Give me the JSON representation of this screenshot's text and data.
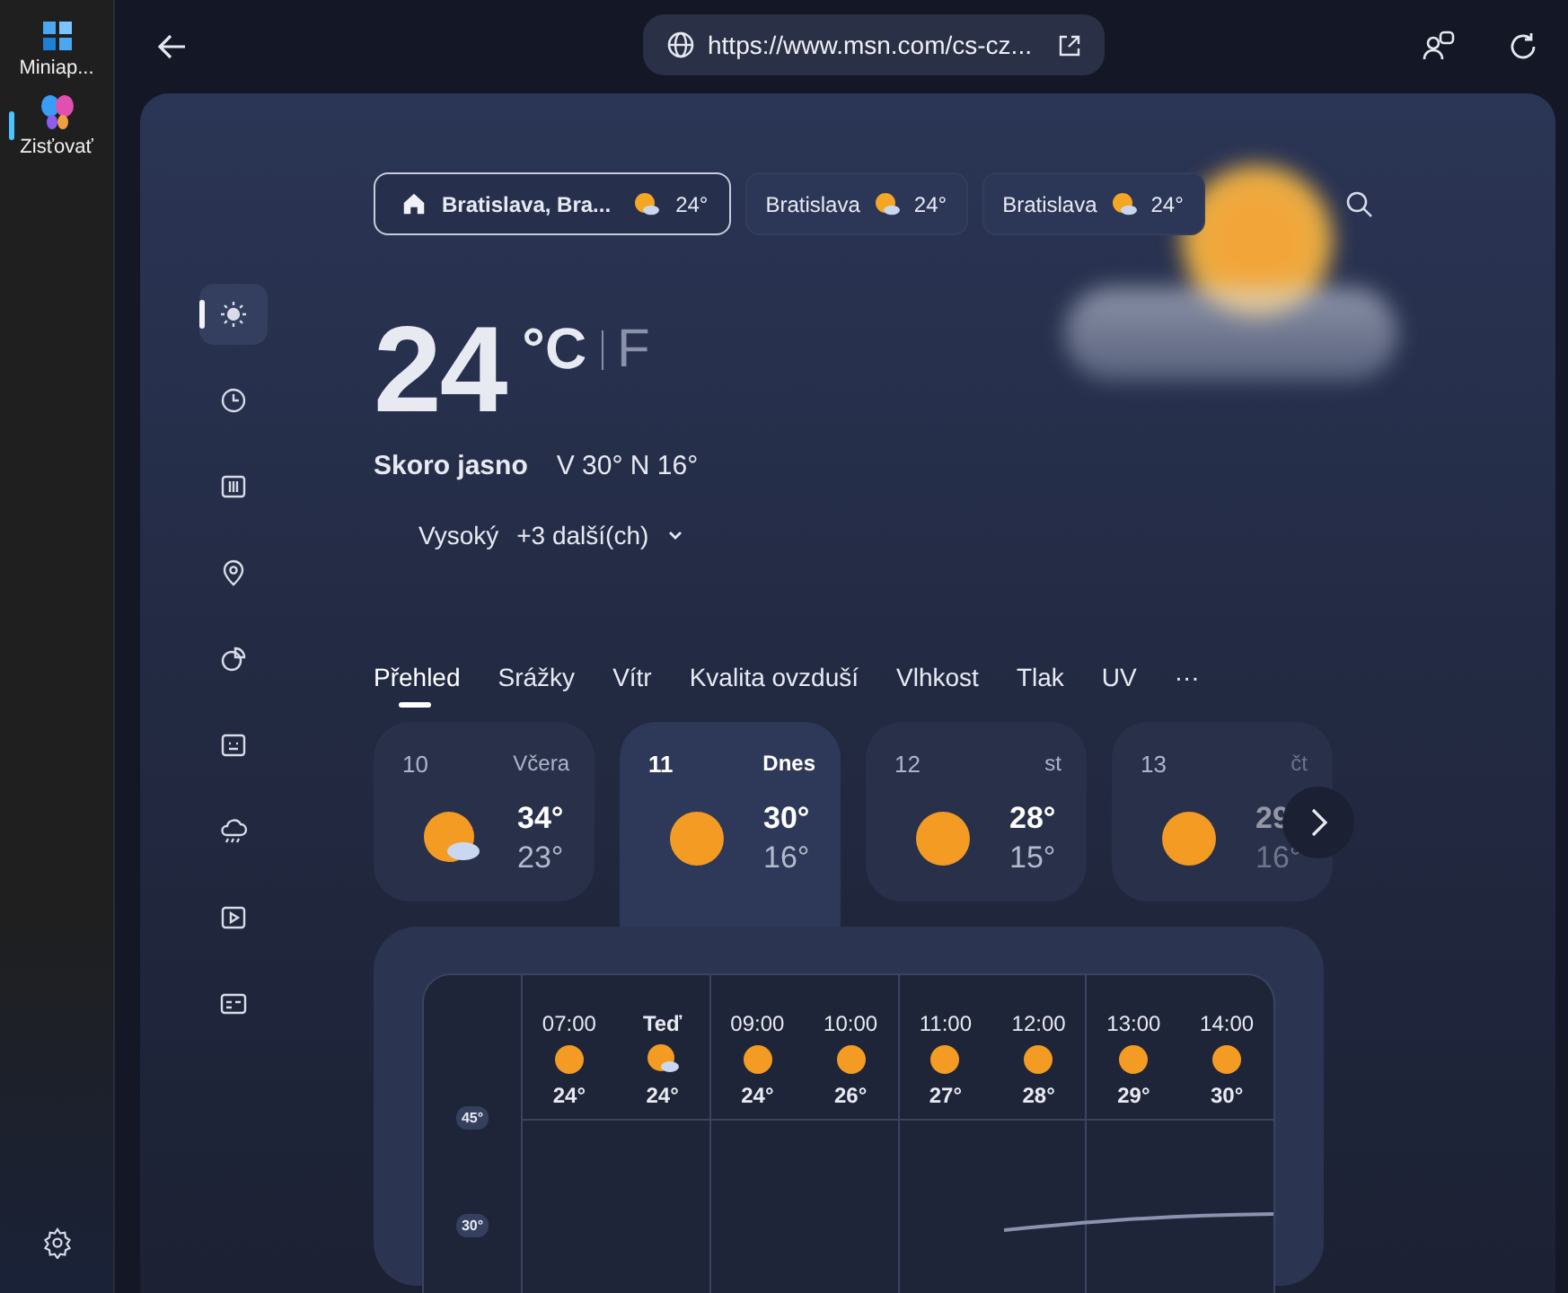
{
  "app_rail": {
    "items": [
      {
        "label": "Miniap...",
        "kind": "apps",
        "selected": false
      },
      {
        "label": "Zisťovať",
        "kind": "discover",
        "selected": true
      }
    ]
  },
  "address_bar": {
    "url": "https://www.msn.com/cs-cz..."
  },
  "locations": [
    {
      "name": "Bratislava, Bra...",
      "temp": "24°",
      "home": true,
      "selected": true
    },
    {
      "name": "Bratislava",
      "temp": "24°",
      "home": false,
      "selected": false
    },
    {
      "name": "Bratislava",
      "temp": "24°",
      "home": false,
      "selected": false
    }
  ],
  "nav": [
    {
      "kind": "sun",
      "selected": true
    },
    {
      "kind": "clock",
      "selected": false
    },
    {
      "kind": "calendar",
      "selected": false
    },
    {
      "kind": "pin",
      "selected": false
    },
    {
      "kind": "pie",
      "selected": false
    },
    {
      "kind": "grid",
      "selected": false
    },
    {
      "kind": "cloud",
      "selected": false
    },
    {
      "kind": "video",
      "selected": false
    },
    {
      "kind": "card",
      "selected": false
    }
  ],
  "current": {
    "temp": "24",
    "unit_c": "°C",
    "unit_f": "F",
    "condition": "Skoro jasno",
    "high_low": "V 30°  N 16°",
    "alert": "Vysoký",
    "more": "+3 další(ch)"
  },
  "tabs": [
    {
      "label": "Přehled",
      "selected": true
    },
    {
      "label": "Srážky",
      "selected": false
    },
    {
      "label": "Vítr",
      "selected": false
    },
    {
      "label": "Kvalita ovzduší",
      "selected": false
    },
    {
      "label": "Vlhkost",
      "selected": false
    },
    {
      "label": "Tlak",
      "selected": false
    },
    {
      "label": "UV",
      "selected": false
    },
    {
      "label": "···",
      "selected": false
    }
  ],
  "days": [
    {
      "date": "10",
      "label": "Včera",
      "high": "34°",
      "low": "23°",
      "kind": "sun-cloud",
      "selected": false
    },
    {
      "date": "11",
      "label": "Dnes",
      "high": "30°",
      "low": "16°",
      "kind": "sun",
      "selected": true
    },
    {
      "date": "12",
      "label": "st",
      "high": "28°",
      "low": "15°",
      "kind": "sun",
      "selected": false
    },
    {
      "date": "13",
      "label": "čt",
      "high": "29",
      "low": "16°",
      "kind": "sun",
      "selected": false
    }
  ],
  "hourly": [
    {
      "time": "07:00",
      "kind": "sun",
      "temp": "24°",
      "now": false
    },
    {
      "time": "Teď",
      "kind": "sun-cloud",
      "temp": "24°",
      "now": true
    },
    {
      "time": "09:00",
      "kind": "sun",
      "temp": "24°",
      "now": false
    },
    {
      "time": "10:00",
      "kind": "sun",
      "temp": "26°",
      "now": false
    },
    {
      "time": "11:00",
      "kind": "sun",
      "temp": "27°",
      "now": false
    },
    {
      "time": "12:00",
      "kind": "sun",
      "temp": "28°",
      "now": false
    },
    {
      "time": "13:00",
      "kind": "sun",
      "temp": "29°",
      "now": false
    },
    {
      "time": "14:00",
      "kind": "sun",
      "temp": "30°",
      "now": false
    }
  ],
  "hourly_axis": [
    "45°",
    "30°"
  ]
}
